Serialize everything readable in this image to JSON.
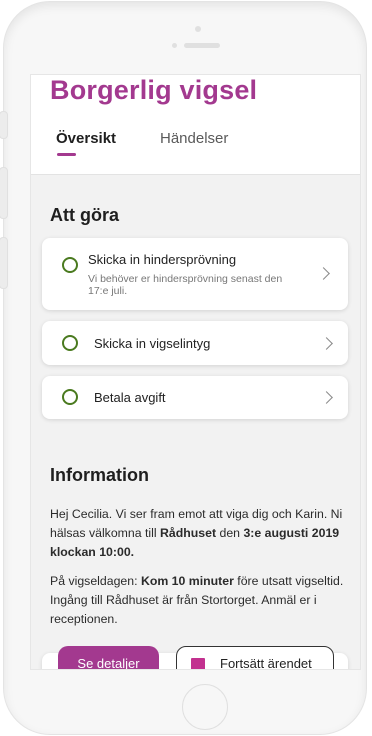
{
  "header": {
    "title": "Borgerlig vigsel",
    "tabs": [
      {
        "label": "Översikt",
        "active": true
      },
      {
        "label": "Händelser",
        "active": false
      }
    ]
  },
  "todo": {
    "heading": "Att göra",
    "items": [
      {
        "title": "Skicka in hindersprövning",
        "subtitle": "Vi behöver er hindersprövning senast den 17:e juli."
      },
      {
        "title": "Skicka in vigselintyg"
      },
      {
        "title": "Betala avgift"
      }
    ]
  },
  "information": {
    "heading": "Information",
    "p1": {
      "t1": "Hej Cecilia. Vi ser fram emot att viga dig och Karin. Ni hälsas välkomna till ",
      "b1": "Rådhuset",
      "t2": " den ",
      "b2": "3:e augusti 2019 klockan 10:00."
    },
    "p2": {
      "t1": "På vigseldagen: ",
      "b1": "Kom 10 minuter",
      "t2": " före utsatt vigseltid. Ingång till Rådhuset är från Stortorget. Anmäl er i receptionen."
    }
  },
  "actions": {
    "primary_label": "Se detaljer",
    "secondary_label": "Fortsätt ärendet"
  },
  "colors": {
    "brand": "#a3398f",
    "check_circle": "#4a7a1f",
    "action_icon": "#c2318f"
  }
}
